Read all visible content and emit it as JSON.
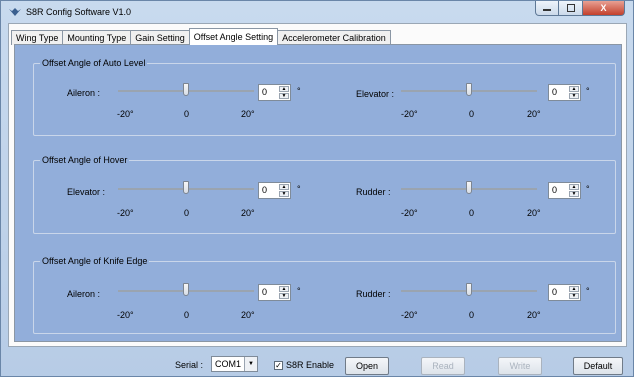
{
  "window": {
    "title": "S8R Config Software V1.0",
    "close_label": "X"
  },
  "tabs": [
    {
      "label": "Wing Type"
    },
    {
      "label": "Mounting Type"
    },
    {
      "label": "Gain Setting"
    },
    {
      "label": "Offset Angle Setting"
    },
    {
      "label": "Accelerometer Calibration"
    }
  ],
  "active_tab": "Offset Angle Setting",
  "groups": [
    {
      "title": "Offset Angle of Auto Level",
      "left": {
        "label": "Aileron :",
        "value": "0",
        "unit": "°",
        "position": 0.5,
        "ticks": [
          "-20°",
          "0",
          "20°"
        ]
      },
      "right": {
        "label": "Elevator :",
        "value": "0",
        "unit": "°",
        "position": 0.5,
        "ticks": [
          "-20°",
          "0",
          "20°"
        ]
      }
    },
    {
      "title": "Offset Angle of Hover",
      "left": {
        "label": "Elevator :",
        "value": "0",
        "unit": "°",
        "position": 0.5,
        "ticks": [
          "-20°",
          "0",
          "20°"
        ]
      },
      "right": {
        "label": "Rudder :",
        "value": "0",
        "unit": "°",
        "position": 0.5,
        "ticks": [
          "-20°",
          "0",
          "20°"
        ]
      }
    },
    {
      "title": "Offset Angle of Knife Edge",
      "left": {
        "label": "Aileron :",
        "value": "0",
        "unit": "°",
        "position": 0.5,
        "ticks": [
          "-20°",
          "0",
          "20°"
        ]
      },
      "right": {
        "label": "Rudder :",
        "value": "0",
        "unit": "°",
        "position": 0.5,
        "ticks": [
          "-20°",
          "0",
          "20°"
        ]
      }
    }
  ],
  "footer": {
    "serial_label": "Serial :",
    "serial_value": "COM1",
    "s8r_enable_label": "S8R Enable",
    "s8r_enable_checked": true,
    "buttons": {
      "open": "Open",
      "read": "Read",
      "write": "Write",
      "default": "Default"
    }
  },
  "colors": {
    "panel": "#92aeda",
    "disabled_text": "#aab3be"
  }
}
